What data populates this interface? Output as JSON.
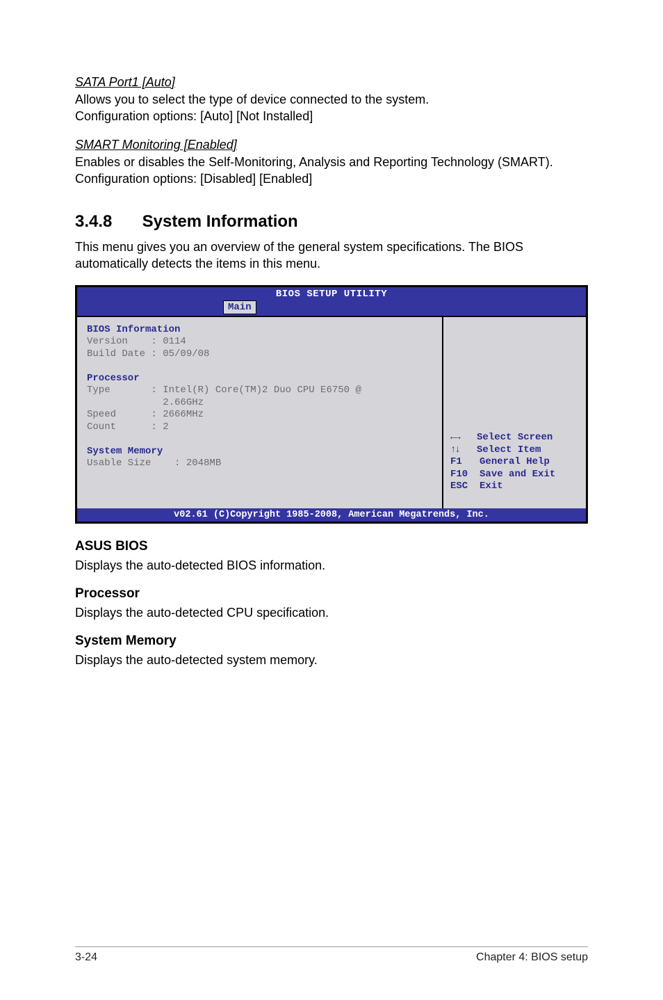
{
  "sata": {
    "heading": "SATA Port1 [Auto]",
    "p1": "Allows you to select the type of device connected to the system.",
    "p2": "Configuration options: [Auto] [Not Installed]"
  },
  "smart": {
    "heading": "SMART Monitoring [Enabled]",
    "p1": "Enables or disables the Self-Monitoring, Analysis and Reporting Technology (SMART). Configuration options: [Disabled] [Enabled]"
  },
  "section": {
    "num": "3.4.8",
    "title": "System Information",
    "intro": "This menu gives you an overview of the general system specifications. The BIOS automatically detects the items in this menu."
  },
  "bios": {
    "header": "BIOS SETUP UTILITY",
    "tab": "Main",
    "info_label": "BIOS Information",
    "version_line": "Version    : 0114",
    "build_line": "Build Date : 05/09/08",
    "processor_label": "Processor",
    "type_line1": "Type       : Intel(R) Core(TM)2 Duo CPU E6750 @",
    "type_line2": "             2.66GHz",
    "speed_line": "Speed      : 2666MHz",
    "count_line": "Count      : 2",
    "sysmem_label": "System Memory",
    "usable_line": "Usable Size    : 2048MB",
    "footer": "v02.61 (C)Copyright 1985-2008, American Megatrends, Inc.",
    "help": {
      "select_screen": "Select Screen",
      "select_item": "Select Item",
      "f1_key": "F1",
      "f1_txt": "General Help",
      "f10_key": "F10",
      "f10_txt": "Save and Exit",
      "esc_key": "ESC",
      "esc_txt": "Exit"
    }
  },
  "asus": {
    "head": "ASUS BIOS",
    "body": "Displays the auto-detected BIOS information."
  },
  "processor": {
    "head": "Processor",
    "body": "Displays the auto-detected CPU specification."
  },
  "sysmem": {
    "head": "System Memory",
    "body": "Displays the auto-detected system memory."
  },
  "footer": {
    "left": "3-24",
    "right": "Chapter 4: BIOS setup"
  }
}
